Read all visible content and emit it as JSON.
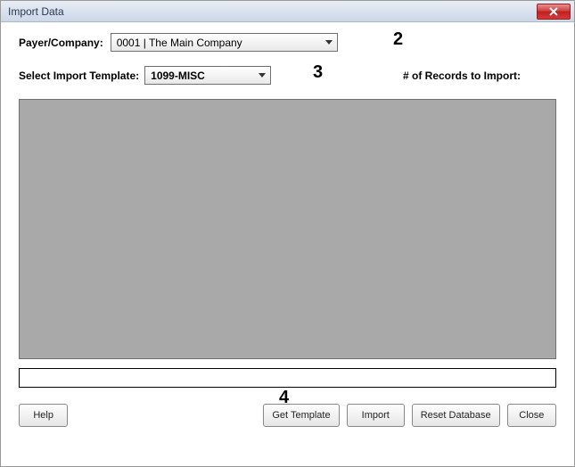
{
  "window": {
    "title": "Import Data"
  },
  "labels": {
    "payer": "Payer/Company:",
    "template": "Select Import Template:",
    "records": "# of Records to Import:"
  },
  "dropdowns": {
    "payer": {
      "selected": "0001 | The Main Company"
    },
    "template": {
      "selected": "1099-MISC"
    }
  },
  "inputs": {
    "records_value": ""
  },
  "status": "",
  "buttons": {
    "help": "Help",
    "get_template": "Get Template",
    "import": "Import",
    "reset": "Reset Database",
    "close": "Close"
  },
  "annotations": {
    "two": "2",
    "three": "3",
    "four": "4"
  },
  "icons": {
    "close_title": "close"
  }
}
